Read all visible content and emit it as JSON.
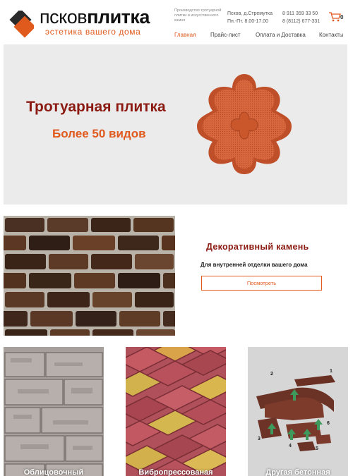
{
  "header": {
    "logo_light": "псков",
    "logo_bold": "плитка",
    "logo_subtitle": "эстетика вашего дома",
    "description": "Производство тротуарной плитки и искусственного камня",
    "address": "Псков, д.Стремутка",
    "hours": "Пн.-Пт. 8.00-17.00",
    "phone1": "8 911 359 33 50",
    "phone2": "8 (8112) 677-331",
    "cart_count": "0",
    "cart_icon": "basket-icon"
  },
  "nav": {
    "items": [
      {
        "label": "Главная",
        "active": true
      },
      {
        "label": "Прайс-лист",
        "active": false
      },
      {
        "label": "Оплата и Доставка",
        "active": false
      },
      {
        "label": "Контакты",
        "active": false
      }
    ]
  },
  "hero": {
    "title": "Тротуарная плитка",
    "subtitle": "Более 50 видов"
  },
  "stone": {
    "title": "Декоративный камень",
    "description": "Для внутренней отделки вашего дома",
    "button": "Посмотреть"
  },
  "cards": [
    {
      "label": "Облицовочный"
    },
    {
      "label": "Вибропрессованая"
    },
    {
      "label": "Другая бетонная"
    }
  ],
  "diagram_numbers": [
    "1",
    "2",
    "3",
    "4",
    "5",
    "6"
  ],
  "colors": {
    "accent": "#e05a1e",
    "title_red": "#8b1a12",
    "hero_bg": "#ebebeb"
  }
}
